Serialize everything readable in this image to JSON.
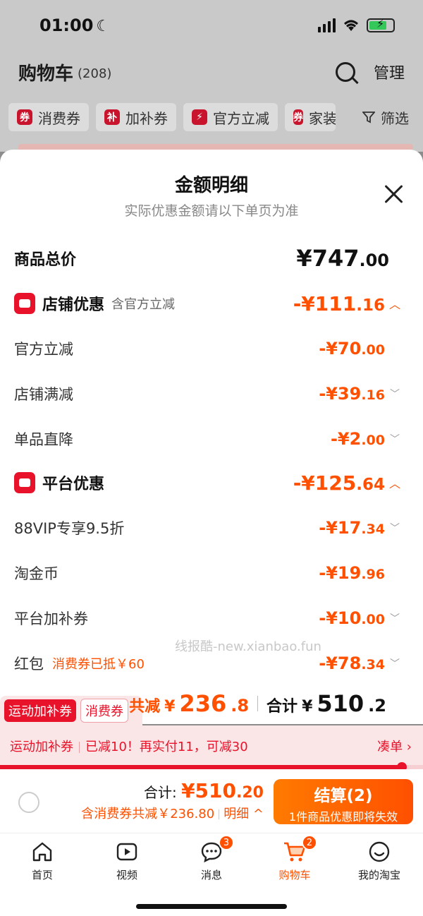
{
  "status": {
    "time": "01:00"
  },
  "cart": {
    "title": "购物车",
    "count": "(208)",
    "manage": "管理",
    "chips": [
      "消费券",
      "加补券",
      "官方立减",
      "家装"
    ],
    "chip_icons": [
      "券",
      "补",
      "⚡",
      "券"
    ],
    "filter": "筛选"
  },
  "sheet": {
    "title": "金额明细",
    "subtitle": "实际优惠金额请以下单页为准",
    "total": {
      "label": "商品总价",
      "int": "¥747",
      "dec": ".00"
    },
    "store": {
      "label": "店铺优惠",
      "note": "含官方立减",
      "int": "-¥111",
      "dec": ".16"
    },
    "store_items": [
      {
        "label": "官方立减",
        "int": "-¥70",
        "dec": ".00"
      },
      {
        "label": "店铺满减",
        "int": "-¥39",
        "dec": ".16"
      },
      {
        "label": "单品直降",
        "int": "-¥2",
        "dec": ".00"
      }
    ],
    "platform": {
      "label": "平台优惠",
      "int": "-¥125",
      "dec": ".64"
    },
    "platform_items": [
      {
        "label": "88VIP专享9.5折",
        "int": "-¥17",
        "dec": ".34"
      },
      {
        "label": "淘金币",
        "int": "-¥19",
        "dec": ".96"
      },
      {
        "label": "平台加补券",
        "int": "-¥10",
        "dec": ".00"
      },
      {
        "label": "红包",
        "note": "消费券已抵￥60",
        "int": "-¥78",
        "dec": ".34"
      }
    ],
    "watermark": "线报酷-new.xianbao.fun"
  },
  "summary": {
    "tags": [
      "运动加补券",
      "消费券"
    ],
    "reduce_label": "共减",
    "reduce_sym": "¥",
    "reduce_int": "236",
    "reduce_dec": ".8",
    "total_label": "合计",
    "total_sym": "¥",
    "total_int": "510",
    "total_dec": ".2"
  },
  "promo": {
    "name": "运动加补券",
    "text": "已减10！再实付11，可减30",
    "action": "凑单 ›",
    "progress": 0.95
  },
  "checkout": {
    "total_label": "合计:",
    "total_int": "¥510",
    "total_dec": ".20",
    "detail": "含消费券共减￥236.80",
    "detail_link": "明细 ^",
    "pay_title": "结算(2)",
    "pay_sub": "1件商品优惠即将失效"
  },
  "tabs": [
    {
      "label": "首页",
      "icon": "home-icon"
    },
    {
      "label": "视频",
      "icon": "video-icon"
    },
    {
      "label": "消息",
      "icon": "message-icon",
      "badge": "3"
    },
    {
      "label": "购物车",
      "icon": "cart-icon",
      "badge": "2"
    },
    {
      "label": "我的淘宝",
      "icon": "profile-icon"
    }
  ]
}
